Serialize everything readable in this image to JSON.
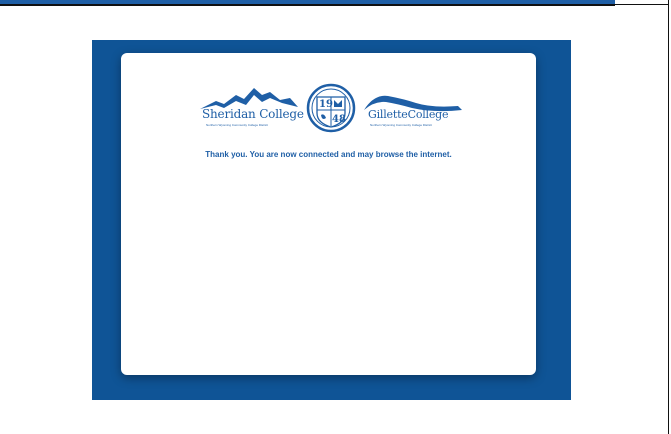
{
  "page": {
    "message": "Thank you. You are now connected and may browse the internet."
  },
  "logos": {
    "sheridan": {
      "name": "Sheridan College",
      "tagline": "Northern Wyoming Community College District"
    },
    "seal": {
      "year_top": "19",
      "year_bottom": "48"
    },
    "gillette": {
      "name": "GilletteCollege",
      "tagline": "Northern Wyoming Community College District"
    }
  },
  "colors": {
    "brand_blue": "#1f5fa6",
    "panel_blue": "#0f5496",
    "card_bg": "#ffffff"
  }
}
